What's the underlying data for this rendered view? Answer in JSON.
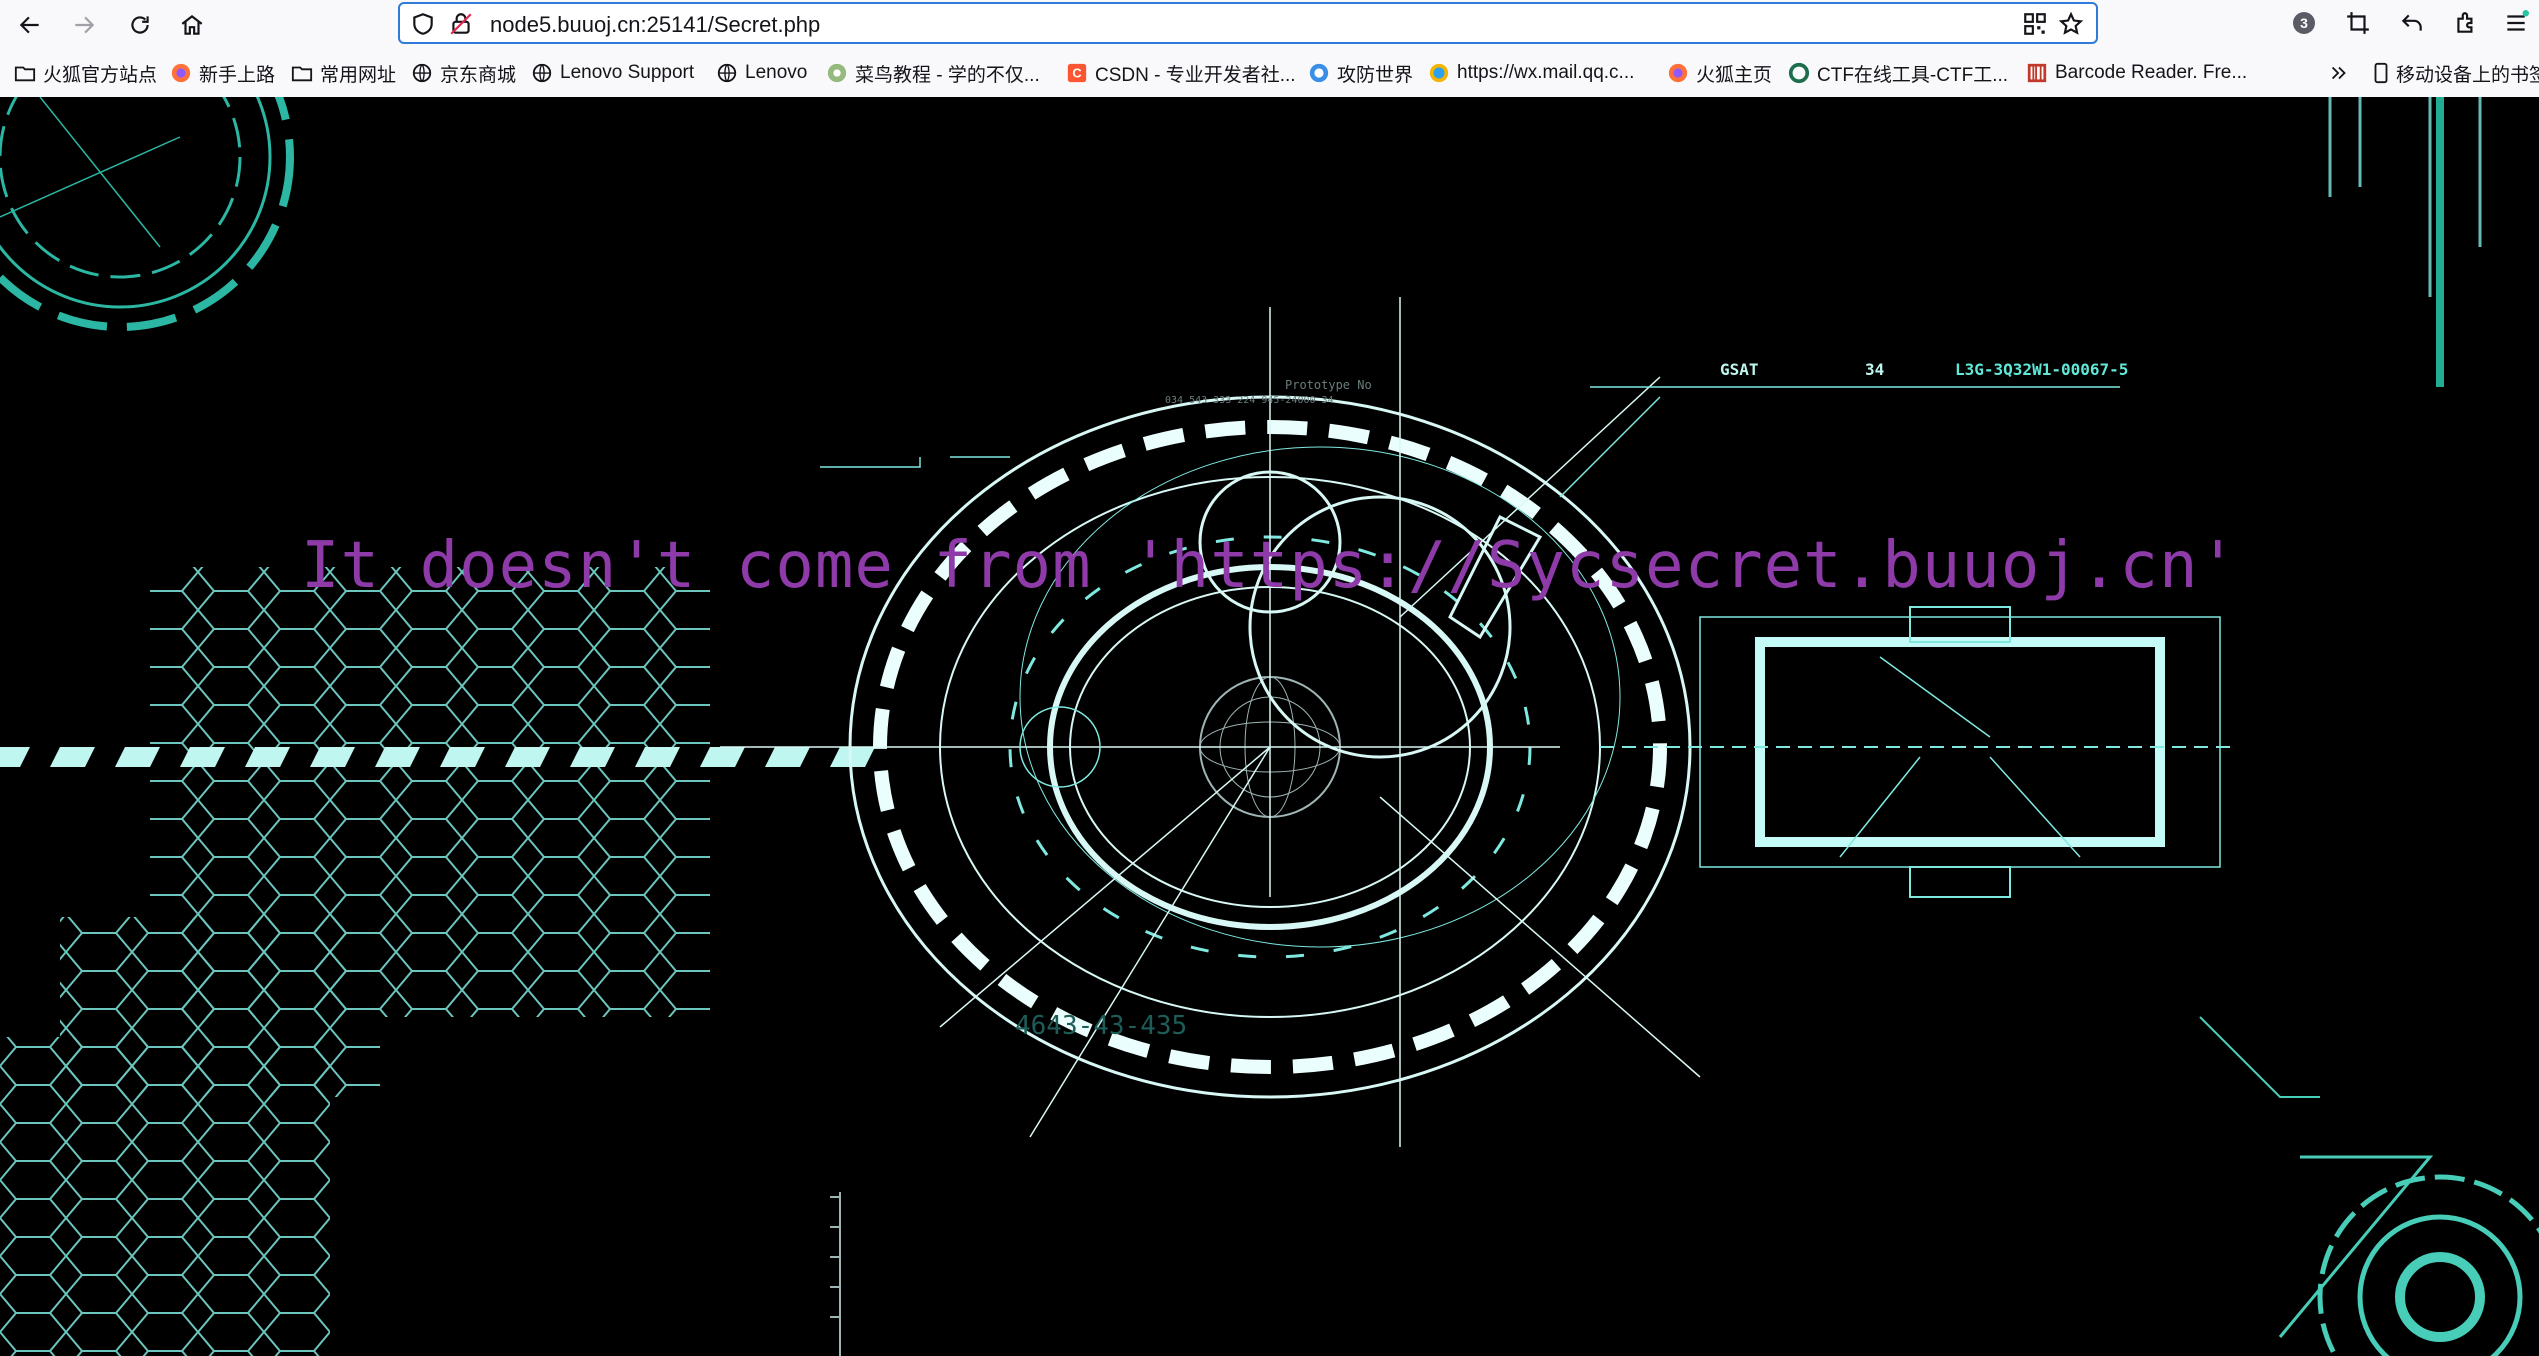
{
  "browser": {
    "url": "node5.buuoj.cn:25141/Secret.php",
    "extensions_badge": "3"
  },
  "bookmarks": [
    {
      "label": "火狐官方站点",
      "icon": "folder-icon"
    },
    {
      "label": "新手上路",
      "icon": "firefox-icon"
    },
    {
      "label": "常用网址",
      "icon": "folder-icon"
    },
    {
      "label": "京东商城",
      "icon": "globe-icon"
    },
    {
      "label": "Lenovo Support",
      "icon": "globe-icon"
    },
    {
      "label": "Lenovo",
      "icon": "globe-icon"
    },
    {
      "label": "菜鸟教程 - 学的不仅...",
      "icon": "runoob-icon"
    },
    {
      "label": "CSDN - 专业开发者社...",
      "icon": "csdn-icon"
    },
    {
      "label": "攻防世界",
      "icon": "adworld-icon"
    },
    {
      "label": "https://wx.mail.qq.c...",
      "icon": "qqmail-icon"
    },
    {
      "label": "火狐主页",
      "icon": "firefox-icon"
    },
    {
      "label": "CTF在线工具-CTF工...",
      "icon": "ctftools-icon"
    },
    {
      "label": "Barcode Reader. Fre...",
      "icon": "barcode-icon"
    }
  ],
  "mobile_bookmarks_label": "移动设备上的书签",
  "page": {
    "message": "It doesn't come from 'https://Sycsecret.buuoj.cn'"
  },
  "decor_text": {
    "gsat": "GSAT",
    "gsat_num": "34",
    "serial": "L3G-3Q32W1-00067-5",
    "prototype": "Prototype No",
    "small_code": "034 543 333 224 945-24000 34",
    "bottom_code": "4643-43-435"
  },
  "colors": {
    "message": "#8e3aa8",
    "hud": "#5fe8d8",
    "url_focus": "#2f7bd9"
  }
}
